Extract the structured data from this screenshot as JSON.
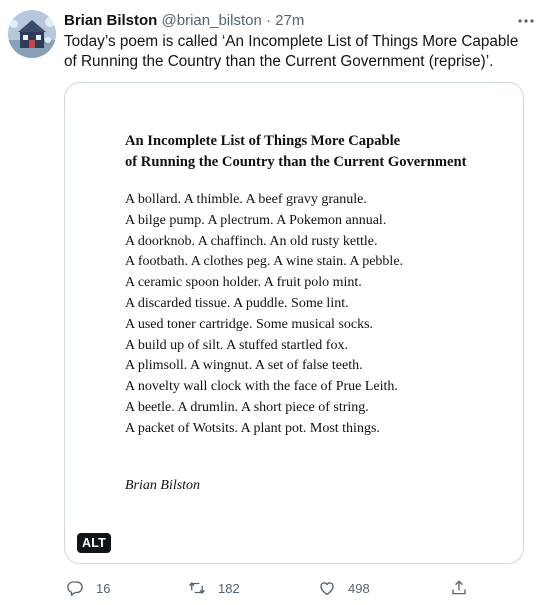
{
  "tweet": {
    "display_name": "Brian Bilston",
    "handle": "@brian_bilston",
    "separator": "·",
    "time": "27m",
    "text": "Today’s poem is called ‘An Incomplete List of Things More Capable of Running the Country than the Current Government (reprise)’."
  },
  "poem": {
    "title_lines": [
      "An Incomplete List of Things More Capable",
      "of Running the Country than the Current Government"
    ],
    "lines": [
      "A bollard. A thimble. A beef gravy granule.",
      "A bilge pump. A plectrum. A Pokemon annual.",
      "A doorknob. A chaffinch. An old rusty kettle.",
      "A footbath. A clothes peg. A wine stain. A pebble.",
      "A ceramic spoon holder. A fruit polo mint.",
      "A discarded tissue. A puddle. Some lint.",
      "A used toner cartridge. Some musical socks.",
      "A build up of silt. A stuffed startled fox.",
      "A plimsoll. A wingnut. A set of false teeth.",
      "A novelty wall clock with the face of Prue Leith.",
      "A beetle. A drumlin. A short piece of string.",
      "A packet of Wotsits. A plant pot. Most things."
    ],
    "author": "Brian Bilston"
  },
  "media": {
    "alt_badge": "ALT"
  },
  "actions": {
    "replies": "16",
    "retweets": "182",
    "likes": "498",
    "icons": [
      "reply-icon",
      "retweet-icon",
      "like-icon",
      "share-icon"
    ]
  },
  "colors": {
    "text": "#0f1419",
    "secondary": "#536471",
    "border": "#cfd9de"
  }
}
